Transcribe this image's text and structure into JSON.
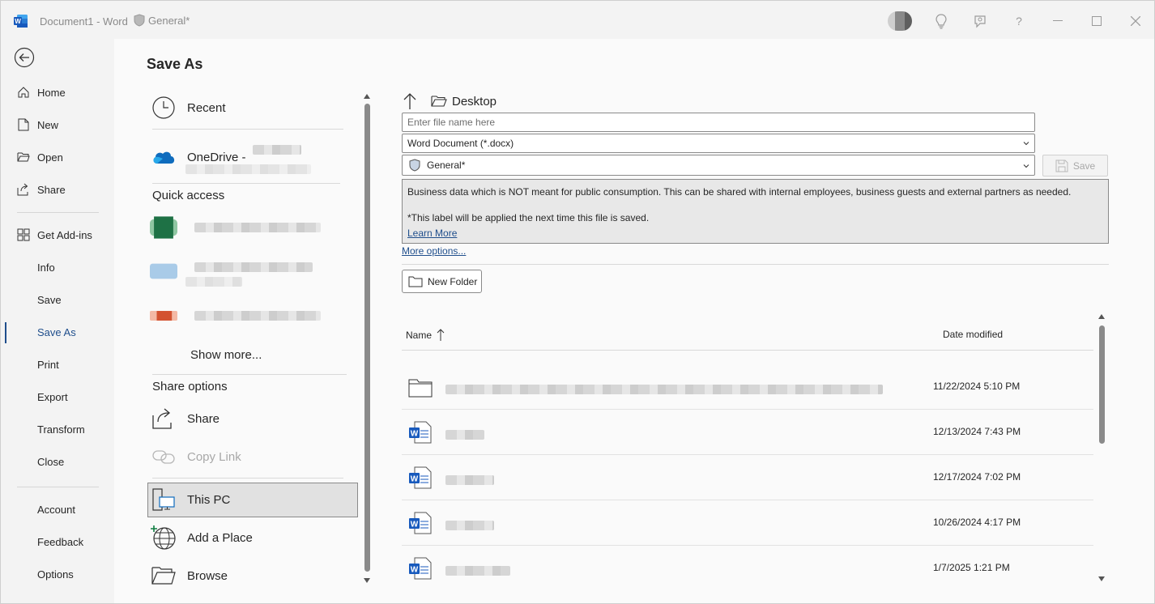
{
  "titlebar": {
    "doc_title": "Document1  -  Word",
    "label": "General*"
  },
  "nav": {
    "items": [
      {
        "label": "Home",
        "icon": "home-icon"
      },
      {
        "label": "New",
        "icon": "new-document-icon"
      },
      {
        "label": "Open",
        "icon": "open-folder-icon"
      },
      {
        "label": "Share",
        "icon": "share-icon"
      },
      {
        "label": "Get Add-ins",
        "icon": "grid-icon"
      },
      {
        "label": "Info"
      },
      {
        "label": "Save"
      },
      {
        "label": "Save As"
      },
      {
        "label": "Print"
      },
      {
        "label": "Export"
      },
      {
        "label": "Transform"
      },
      {
        "label": "Close"
      },
      {
        "label": "Account"
      },
      {
        "label": "Feedback"
      },
      {
        "label": "Options"
      }
    ],
    "active": "Save As"
  },
  "page_title": "Save As",
  "locations": {
    "recent": "Recent",
    "onedrive": "OneDrive - ",
    "quick_access": "Quick access",
    "show_more": "Show more...",
    "share_options": "Share options",
    "share": "Share",
    "copy_link": "Copy Link",
    "this_pc": "This PC",
    "add_place": "Add a Place",
    "browse": "Browse"
  },
  "pane": {
    "current_folder": "Desktop",
    "filename_placeholder": "Enter file name here",
    "file_type": "Word Document (*.docx)",
    "sensitivity": "General*",
    "save_label": "Save",
    "info_line1": "Business data which is NOT meant for public consumption. This can be shared with internal employees, business guests and external partners as needed.",
    "info_line2": "*This label will be applied the next time this file is saved.",
    "learn_more": "Learn More",
    "more_options": "More options...",
    "new_folder": "New Folder",
    "col_name": "Name",
    "col_date": "Date modified"
  },
  "files": [
    {
      "type": "folder",
      "date": "11/22/2024 5:10 PM"
    },
    {
      "type": "word",
      "date": "12/13/2024 7:43 PM"
    },
    {
      "type": "word",
      "date": "12/17/2024 7:02 PM"
    },
    {
      "type": "word",
      "date": "10/26/2024 4:17 PM"
    },
    {
      "type": "word",
      "date": "1/7/2025 1:21 PM"
    }
  ],
  "colors": {
    "accent": "#1f4e8c",
    "word_blue": "#185abd"
  }
}
